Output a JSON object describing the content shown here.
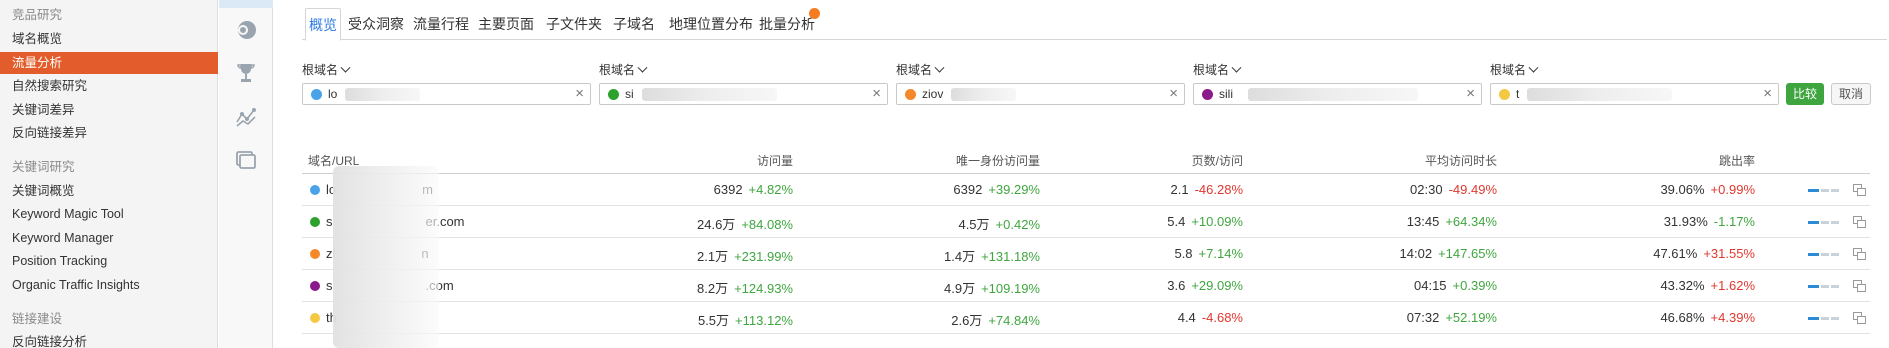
{
  "sidebar": {
    "items": [
      {
        "label": "竞品研究",
        "kind": "head"
      },
      {
        "label": "域名概览",
        "kind": "item"
      },
      {
        "label": "流量分析",
        "kind": "active"
      },
      {
        "label": "自然搜索研究",
        "kind": "item"
      },
      {
        "label": "关键词差异",
        "kind": "item"
      },
      {
        "label": "反向链接差异",
        "kind": "item"
      },
      {
        "label": "关键词研究",
        "kind": "head"
      },
      {
        "label": "关键词概览",
        "kind": "item"
      },
      {
        "label": "Keyword Magic Tool",
        "kind": "item"
      },
      {
        "label": "Keyword Manager",
        "kind": "item"
      },
      {
        "label": "Position Tracking",
        "kind": "item"
      },
      {
        "label": "Organic Traffic Insights",
        "kind": "item"
      },
      {
        "label": "链接建设",
        "kind": "head"
      },
      {
        "label": "反向链接分析",
        "kind": "item"
      }
    ]
  },
  "rail": {
    "icons": [
      "pie-chart-icon",
      "trophy-icon",
      "network-graph-icon",
      "windows-icon"
    ]
  },
  "tabs": [
    {
      "label": "概览",
      "active": true
    },
    {
      "label": "受众洞察"
    },
    {
      "label": "流量行程"
    },
    {
      "label": "主要页面"
    },
    {
      "label": "子文件夹"
    },
    {
      "label": "子域名"
    },
    {
      "label": "地理位置分布"
    },
    {
      "label": "批量分析",
      "badge": true
    }
  ],
  "compare": {
    "selectors": [
      {
        "label": "根域名",
        "value": "lo",
        "color": "#4aa3e8"
      },
      {
        "label": "根域名",
        "value": "si",
        "color": "#2da12d"
      },
      {
        "label": "根域名",
        "value": "ziov",
        "color": "#f5892a"
      },
      {
        "label": "根域名",
        "value": "sili",
        "color": "#8b1a8b"
      },
      {
        "label": "根域名",
        "value": "t",
        "color": "#f5c842"
      }
    ],
    "compare_label": "比较",
    "cancel_label": "取消"
  },
  "table": {
    "headers": [
      "域名/URL",
      "访问量",
      "唯一身份访问量",
      "页数/访问",
      "平均访问时长",
      "跳出率"
    ],
    "rows": [
      {
        "color": "#4aa3e8",
        "domain_prefix": "lo",
        "domain_suffix": "m",
        "visits": "6392",
        "visits_chg": "+4.82%",
        "visits_up": true,
        "uniq": "6392",
        "uniq_chg": "+39.29%",
        "uniq_up": true,
        "pages": "2.1",
        "pages_chg": "-46.28%",
        "pages_up": false,
        "dur": "02:30",
        "dur_chg": "-49.49%",
        "dur_up": false,
        "bounce": "39.06%",
        "bounce_chg": "+0.99%",
        "bounce_up": false
      },
      {
        "color": "#2da12d",
        "domain_prefix": "s",
        "domain_suffix": "er.com",
        "visits": "24.6万",
        "visits_chg": "+84.08%",
        "visits_up": true,
        "uniq": "4.5万",
        "uniq_chg": "+0.42%",
        "uniq_up": true,
        "pages": "5.4",
        "pages_chg": "+10.09%",
        "pages_up": true,
        "dur": "13:45",
        "dur_chg": "+64.34%",
        "dur_up": true,
        "bounce": "31.93%",
        "bounce_chg": "-1.17%",
        "bounce_up": true
      },
      {
        "color": "#f5892a",
        "domain_prefix": "zl",
        "domain_suffix": "n",
        "visits": "2.1万",
        "visits_chg": "+231.99%",
        "visits_up": true,
        "uniq": "1.4万",
        "uniq_chg": "+131.18%",
        "uniq_up": true,
        "pages": "5.8",
        "pages_chg": "+7.14%",
        "pages_up": true,
        "dur": "14:02",
        "dur_chg": "+147.65%",
        "dur_up": true,
        "bounce": "47.61%",
        "bounce_chg": "+31.55%",
        "bounce_up": false
      },
      {
        "color": "#8b1a8b",
        "domain_prefix": "s",
        "domain_suffix": ".com",
        "visits": "8.2万",
        "visits_chg": "+124.93%",
        "visits_up": true,
        "uniq": "4.9万",
        "uniq_chg": "+109.19%",
        "uniq_up": true,
        "pages": "3.6",
        "pages_chg": "+29.09%",
        "pages_up": true,
        "dur": "04:15",
        "dur_chg": "+0.39%",
        "dur_up": true,
        "bounce": "43.32%",
        "bounce_chg": "+1.62%",
        "bounce_up": false
      },
      {
        "color": "#f5c842",
        "domain_prefix": "th",
        "domain_suffix": "",
        "visits": "5.5万",
        "visits_chg": "+113.12%",
        "visits_up": true,
        "uniq": "2.6万",
        "uniq_chg": "+74.84%",
        "uniq_up": true,
        "pages": "4.4",
        "pages_chg": "-4.68%",
        "pages_up": false,
        "dur": "07:32",
        "dur_chg": "+52.19%",
        "dur_up": true,
        "bounce": "46.68%",
        "bounce_chg": "+4.39%",
        "bounce_up": false
      }
    ]
  }
}
